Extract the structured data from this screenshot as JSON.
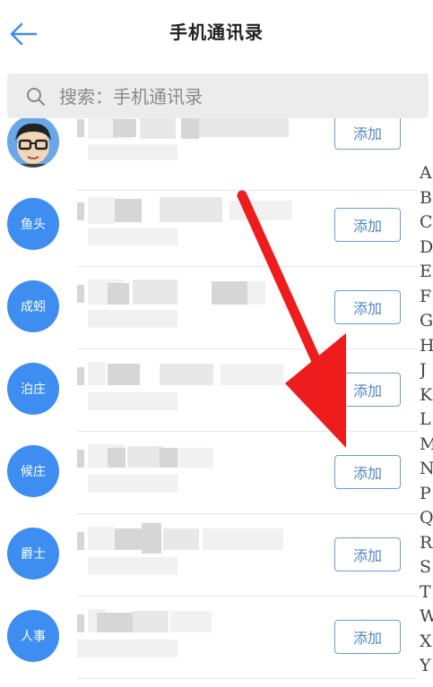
{
  "header": {
    "title": "手机通讯录"
  },
  "search": {
    "placeholder": "搜索：手机通讯录"
  },
  "contacts": [
    {
      "avatar": "",
      "button": "添加"
    },
    {
      "avatar": "鱼头",
      "button": "添加"
    },
    {
      "avatar": "成蚓",
      "button": "添加"
    },
    {
      "avatar": "泊庄",
      "button": "添加"
    },
    {
      "avatar": "候庄",
      "button": "添加"
    },
    {
      "avatar": "爵士",
      "button": "添加"
    },
    {
      "avatar": "人事",
      "button": "添加"
    }
  ],
  "index_letters": [
    "A",
    "B",
    "C",
    "D",
    "E",
    "F",
    "G",
    "H",
    "J",
    "K",
    "L",
    "M",
    "N",
    "P",
    "Q",
    "R",
    "S",
    "T",
    "W",
    "X",
    "Y"
  ],
  "colors": {
    "avatar_bg": "#3d8ef0",
    "button_border": "#6b9ecf",
    "arrow": "#ee1c1c",
    "back": "#3d8ef0"
  },
  "icons": {
    "back": "arrow-left-icon",
    "search": "search-icon"
  }
}
